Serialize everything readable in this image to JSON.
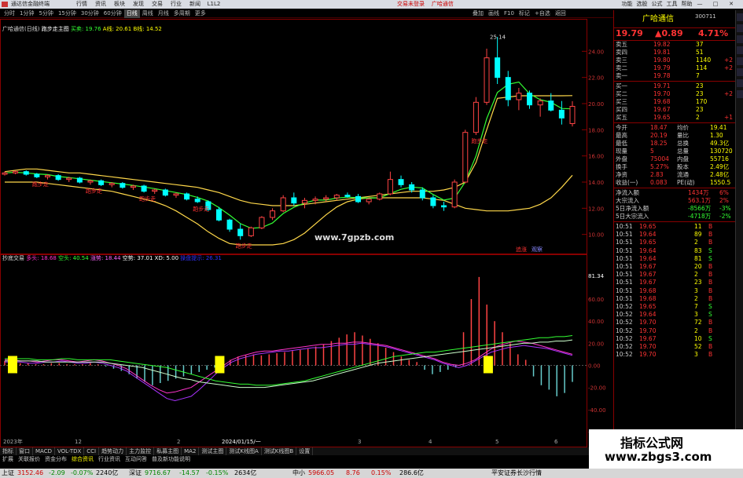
{
  "app": {
    "title": "通达信金融终端",
    "menus": [
      "行情",
      "资讯",
      "板块",
      "发现",
      "交易",
      "行业",
      "新闻",
      "L1L2"
    ],
    "promo": "交易未登录",
    "promo2": "广哈通信",
    "right_menus": [
      "功能",
      "选股",
      "公式",
      "工具",
      "帮助"
    ],
    "window_buttons": [
      "—",
      "□",
      "✕"
    ]
  },
  "toolbar": {
    "periods": [
      "分时",
      "1分钟",
      "5分钟",
      "15分钟",
      "30分钟",
      "60分钟",
      "日线",
      "周线",
      "月线",
      "多周期",
      "更多"
    ],
    "active": "日线",
    "right_items": [
      "叠加",
      "画线",
      "F10",
      "标记",
      "+自选",
      "返回"
    ]
  },
  "chart": {
    "title": "广哈通信(日线)",
    "indicator": "跑步走主图",
    "buy_label": "买卖: 19.76",
    "a_label": "A线: 20.61",
    "b_label": "B线: 14.52",
    "hi_label": "25.14",
    "y_ticks": [
      "24.00",
      "22.00",
      "20.00",
      "18.00",
      "16.00",
      "14.00",
      "12.00",
      "10.00"
    ],
    "signal_text": "跑步走",
    "zj_label": "追涨",
    "gz_label": "观察",
    "sub_title": "抄底交易",
    "sub_items": [
      {
        "t": "多头: 18.68",
        "c": "#f3c"
      },
      {
        "t": "空头: 40.54",
        "c": "#3f3"
      },
      {
        "t": "涨势: 18.44",
        "c": "#f6f"
      },
      {
        "t": "空势: 37.01",
        "c": "#fff"
      },
      {
        "t": "XD: 5.00",
        "c": "#fff"
      },
      {
        "t": "操盘提示: 26.31",
        "c": "#33f"
      }
    ],
    "sub_y_ticks": [
      "81.34",
      "60.00",
      "40.00",
      "20.00",
      "0.00",
      "-20.00",
      "-40.00",
      "-60.00"
    ],
    "x_labels": [
      "2023年",
      "12",
      "2",
      "2024/01/15/一",
      "3",
      "4",
      "5",
      "6"
    ],
    "watermark": "www.7gpzb.com"
  },
  "stock": {
    "name": "广哈通信",
    "code": "300711",
    "price": "19.79",
    "change": "▲0.89",
    "pct": "4.71%",
    "asks": [
      [
        "卖五",
        "19.82",
        "37"
      ],
      [
        "卖四",
        "19.81",
        "51"
      ],
      [
        "卖三",
        "19.80",
        "1140",
        "+2"
      ],
      [
        "卖二",
        "19.79",
        "114",
        "+2"
      ],
      [
        "卖一",
        "19.78",
        "7"
      ]
    ],
    "bids": [
      [
        "买一",
        "19.71",
        "23"
      ],
      [
        "买二",
        "19.70",
        "23",
        "+2"
      ],
      [
        "买三",
        "19.68",
        "170"
      ],
      [
        "买四",
        "19.67",
        "23"
      ],
      [
        "买五",
        "19.65",
        "2",
        "+1"
      ]
    ],
    "stats": [
      [
        "今开",
        "18.47",
        "均价",
        "19.41"
      ],
      [
        "最高",
        "20.19",
        "量比",
        "1.30"
      ],
      [
        "最低",
        "18.25",
        "总换",
        "49.3亿"
      ],
      [
        "现量",
        "5",
        "总量",
        "130720"
      ],
      [
        "外盘",
        "75004",
        "内盘",
        "55716"
      ],
      [
        "换手",
        "5.27%",
        "股本",
        "2.49亿"
      ],
      [
        "净资",
        "2.83",
        "流通",
        "2.48亿"
      ],
      [
        "收益(一)",
        "0.083",
        "PE(动)",
        "1550.5"
      ]
    ],
    "flows": [
      [
        "净流入额",
        "1434万",
        "6%"
      ],
      [
        "大宗流入",
        "563.1万",
        "2%"
      ],
      [
        "5日净流入额",
        "-8566万",
        "-3%"
      ],
      [
        "5日大宗流入",
        "-4718万",
        "-2%"
      ]
    ],
    "ticks": [
      [
        "10:51",
        "19.65",
        "11",
        "B"
      ],
      [
        "10:51",
        "19.64",
        "89",
        "B"
      ],
      [
        "10:51",
        "19.65",
        "2",
        "B"
      ],
      [
        "10:51",
        "19.64",
        "83",
        "S"
      ],
      [
        "10:51",
        "19.64",
        "81",
        "S"
      ],
      [
        "10:51",
        "19.67",
        "20",
        "B"
      ],
      [
        "10:51",
        "19.67",
        "2",
        "B"
      ],
      [
        "10:51",
        "19.67",
        "23",
        "B"
      ],
      [
        "10:51",
        "19.68",
        "3",
        "B"
      ],
      [
        "10:51",
        "19.68",
        "2",
        "B"
      ],
      [
        "10:52",
        "19.65",
        "7",
        "S"
      ],
      [
        "10:52",
        "19.64",
        "3",
        "S"
      ],
      [
        "10:52",
        "19.70",
        "72",
        "B"
      ],
      [
        "10:52",
        "19.70",
        "2",
        "B"
      ],
      [
        "10:52",
        "19.67",
        "10",
        "S"
      ],
      [
        "10:52",
        "19.70",
        "52",
        "B"
      ],
      [
        "10:52",
        "19.70",
        "3",
        "B"
      ]
    ]
  },
  "tabs": [
    "指标",
    "窗口",
    "MACD",
    "VOL-TDX",
    "CCI",
    "趋势动力",
    "主力监控",
    "私募主图",
    "MA2",
    "测试主图",
    "测试K线图A",
    "测试K线图B",
    "设置"
  ],
  "tabs2": [
    "扩展",
    "关联报价",
    "资金分布",
    "综合资讯",
    "行业资讯",
    "互动问答",
    "普及新功能说明"
  ],
  "tabs2_active": "综合资讯",
  "status": {
    "sh": "上证",
    "sh_val": "3152.46",
    "sh_chg": "-2.09",
    "sh_pct": "-0.07%",
    "sh_amt": "2240亿",
    "sz": "深证",
    "sz_val": "9716.67",
    "sz_chg": "-14.57",
    "sz_pct": "-0.15%",
    "sz_amt": "2634亿",
    "zx": "中小",
    "zx_val": "5966.05",
    "zx_chg": "8.76",
    "zx_pct": "0.15%",
    "zx_amt": "286.6亿",
    "broker": "平安证券长沙行情"
  },
  "watermark": {
    "line1": "指标公式网",
    "line2": "www.zbgs3.com"
  },
  "series": {
    "candles": [
      [
        14.6,
        14.8,
        14.5,
        14.7
      ],
      [
        14.7,
        14.9,
        14.6,
        14.8
      ],
      [
        14.8,
        14.9,
        14.5,
        14.6
      ],
      [
        14.6,
        14.7,
        14.3,
        14.4
      ],
      [
        14.4,
        14.6,
        14.2,
        14.5
      ],
      [
        14.5,
        14.6,
        14.1,
        14.2
      ],
      [
        14.2,
        14.4,
        14.0,
        14.3
      ],
      [
        14.3,
        14.4,
        13.9,
        14.0
      ],
      [
        14.0,
        14.2,
        13.8,
        14.1
      ],
      [
        14.1,
        14.2,
        13.7,
        13.8
      ],
      [
        13.8,
        14.0,
        13.6,
        13.9
      ],
      [
        13.9,
        14.0,
        13.5,
        13.6
      ],
      [
        13.6,
        13.8,
        13.4,
        13.7
      ],
      [
        13.7,
        13.8,
        13.2,
        13.3
      ],
      [
        13.3,
        13.5,
        13.1,
        13.4
      ],
      [
        13.4,
        13.5,
        12.9,
        13.0
      ],
      [
        13.0,
        13.2,
        12.8,
        13.1
      ],
      [
        13.1,
        13.2,
        12.6,
        12.7
      ],
      [
        12.7,
        12.9,
        12.4,
        12.5
      ],
      [
        12.5,
        12.6,
        11.8,
        11.9
      ],
      [
        11.9,
        12.1,
        11.0,
        11.1
      ],
      [
        11.1,
        11.2,
        10.2,
        10.4
      ],
      [
        10.4,
        10.8,
        9.6,
        9.9
      ],
      [
        9.9,
        10.6,
        9.8,
        10.5
      ],
      [
        10.5,
        11.4,
        10.4,
        11.3
      ],
      [
        11.3,
        12.0,
        11.1,
        11.8
      ],
      [
        11.8,
        13.0,
        11.7,
        12.8
      ],
      [
        12.8,
        13.2,
        12.2,
        12.4
      ],
      [
        12.4,
        12.8,
        12.0,
        12.6
      ],
      [
        12.6,
        12.9,
        12.3,
        12.7
      ],
      [
        12.7,
        13.0,
        12.5,
        12.8
      ],
      [
        12.8,
        13.1,
        12.6,
        13.0
      ],
      [
        13.0,
        13.2,
        12.8,
        12.9
      ],
      [
        12.9,
        13.1,
        12.4,
        12.5
      ],
      [
        12.5,
        12.8,
        12.3,
        12.7
      ],
      [
        12.7,
        13.2,
        12.6,
        13.1
      ],
      [
        13.1,
        14.8,
        13.0,
        14.2
      ],
      [
        14.2,
        14.5,
        13.6,
        13.8
      ],
      [
        13.8,
        14.0,
        13.2,
        13.4
      ],
      [
        13.4,
        13.6,
        12.6,
        12.8
      ],
      [
        12.8,
        13.0,
        12.0,
        12.2
      ],
      [
        12.2,
        12.5,
        11.8,
        12.1
      ],
      [
        12.1,
        14.2,
        12.0,
        14.0
      ],
      [
        14.0,
        18.0,
        13.9,
        17.8
      ],
      [
        17.8,
        20.5,
        17.6,
        20.1
      ],
      [
        20.1,
        24.2,
        19.9,
        23.5
      ],
      [
        23.5,
        25.1,
        21.5,
        22.0
      ],
      [
        22.0,
        22.5,
        19.8,
        20.3
      ],
      [
        20.3,
        21.2,
        19.5,
        20.8
      ],
      [
        20.8,
        21.0,
        19.6,
        19.9
      ],
      [
        19.9,
        20.4,
        19.0,
        20.2
      ],
      [
        20.2,
        20.8,
        19.4,
        19.5
      ],
      [
        19.5,
        20.2,
        18.4,
        18.9
      ],
      [
        18.47,
        20.19,
        18.25,
        19.79
      ]
    ],
    "upper": [
      14.8,
      14.9,
      15.0,
      15.0,
      14.9,
      14.8,
      14.7,
      14.7,
      14.6,
      14.5,
      14.4,
      14.3,
      14.2,
      14.1,
      14.0,
      13.9,
      13.8,
      13.7,
      13.6,
      13.4,
      13.2,
      12.9,
      12.6,
      12.4,
      12.3,
      12.2,
      12.2,
      12.2,
      12.3,
      12.4,
      12.5,
      12.6,
      12.7,
      12.8,
      12.9,
      13.0,
      13.1,
      13.2,
      13.3,
      13.3,
      13.3,
      13.4,
      13.6,
      14.0,
      15.5,
      18.0,
      20.4,
      20.5,
      20.6,
      20.6,
      20.6,
      20.6,
      20.6,
      20.61
    ],
    "lower": [
      14.0,
      14.0,
      14.0,
      14.0,
      13.9,
      13.8,
      13.7,
      13.6,
      13.5,
      13.4,
      13.3,
      13.1,
      12.9,
      12.7,
      12.5,
      12.2,
      11.8,
      11.3,
      10.8,
      10.2,
      9.7,
      9.3,
      9.2,
      9.2,
      9.2,
      9.2,
      9.3,
      9.6,
      10.1,
      10.8,
      11.5,
      12.1,
      12.5,
      12.7,
      12.8,
      12.8,
      12.8,
      12.8,
      12.8,
      12.8,
      12.7,
      12.6,
      12.3,
      12.0,
      11.9,
      11.8,
      11.8,
      11.8,
      11.9,
      12.0,
      12.3,
      12.8,
      13.6,
      14.52
    ],
    "hist": [
      4,
      3,
      2,
      2,
      1,
      1,
      2,
      2,
      1,
      1,
      1,
      2,
      1,
      -1,
      -3,
      -5,
      -8,
      -12,
      -15,
      -18,
      -16,
      -14,
      -12,
      -10,
      -8,
      -6,
      -4,
      -2,
      2,
      5,
      8,
      9,
      10,
      9,
      10,
      11,
      12,
      13,
      14,
      15,
      17,
      19,
      22,
      25,
      28,
      30,
      27,
      24,
      20,
      16,
      12,
      8,
      5,
      3,
      -4,
      -8,
      -6,
      -4,
      -2,
      30,
      60,
      80,
      55,
      40,
      30,
      20,
      10,
      5,
      -10,
      -18,
      -22,
      -28,
      -25,
      -15
    ],
    "l1": [
      5,
      5,
      4,
      4,
      3,
      4,
      5,
      5,
      4,
      3,
      4,
      5,
      4,
      2,
      0,
      -3,
      -8,
      -13,
      -18,
      -22,
      -25,
      -24,
      -22,
      -20,
      -15,
      -10,
      -5,
      0,
      5,
      8,
      10,
      12,
      13,
      13,
      14,
      15,
      16,
      17,
      18,
      19,
      19,
      20,
      20,
      21,
      21,
      20,
      19,
      18,
      16,
      14,
      12,
      10,
      8,
      6,
      3,
      1,
      0,
      2,
      5,
      10,
      15,
      18,
      20,
      22,
      21,
      20,
      18,
      16,
      14,
      12,
      10
    ],
    "l2": [
      3,
      3,
      3,
      2,
      2,
      3,
      3,
      4,
      3,
      2,
      2,
      3,
      2,
      0,
      -2,
      -5,
      -10,
      -15,
      -20,
      -25,
      -30,
      -32,
      -30,
      -28,
      -22,
      -15,
      -8,
      -2,
      3,
      6,
      8,
      10,
      11,
      12,
      13,
      13,
      14,
      15,
      16,
      16,
      17,
      18,
      19,
      19,
      20,
      19,
      18,
      17,
      15,
      13,
      11,
      9,
      7,
      5,
      2,
      0,
      -2,
      0,
      4,
      8,
      12,
      14,
      16,
      17,
      18,
      17,
      16,
      15,
      13,
      11,
      9
    ],
    "l3": [
      6,
      6,
      6,
      6,
      5,
      5,
      5,
      6,
      6,
      5,
      5,
      5,
      5,
      5,
      4,
      3,
      2,
      1,
      0,
      -1,
      -2,
      -4,
      -6,
      -8,
      -10,
      -12,
      -14,
      -15,
      -16,
      -17,
      -17,
      -18,
      -18,
      -18,
      -17,
      -16,
      -15,
      -14,
      -12,
      -10,
      -8,
      -6,
      -4,
      -2,
      0,
      2,
      4,
      6,
      8,
      9,
      10,
      11,
      12,
      12,
      13,
      14,
      15,
      16,
      17,
      18,
      19,
      20,
      21,
      22,
      23,
      24,
      25,
      25,
      26,
      26,
      27
    ],
    "l4": [
      4,
      4,
      4,
      4,
      4,
      3,
      3,
      3,
      3,
      3,
      3,
      3,
      3,
      2,
      1,
      0,
      -1,
      -2,
      -4,
      -6,
      -8,
      -10,
      -12,
      -13,
      -15,
      -16,
      -17,
      -18,
      -19,
      -20,
      -20,
      -20,
      -20,
      -19,
      -18,
      -17,
      -16,
      -15,
      -14,
      -12,
      -10,
      -8,
      -6,
      -4,
      -2,
      0,
      2,
      3,
      4,
      5,
      6,
      7,
      8,
      9,
      10,
      11,
      12,
      13,
      14,
      15,
      16,
      17,
      18,
      19,
      20,
      20,
      21,
      21,
      22,
      22,
      23
    ],
    "markers": [
      0,
      27,
      62
    ]
  }
}
